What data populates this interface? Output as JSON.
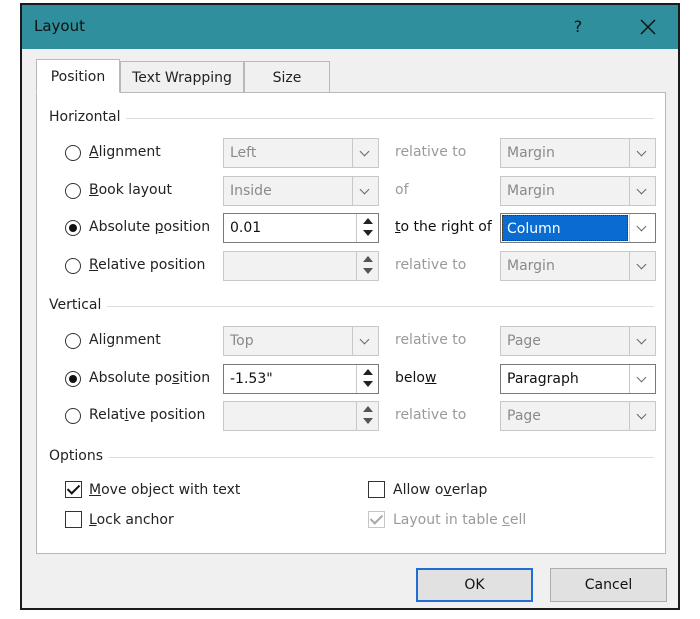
{
  "dialog": {
    "title": "Layout",
    "help": "?"
  },
  "tabs": [
    {
      "label": "Position"
    },
    {
      "label": "Text Wrapping"
    },
    {
      "label": "Size"
    }
  ],
  "horizontal": {
    "heading": "Horizontal",
    "rows": [
      {
        "label_pre": "",
        "label_u": "A",
        "label_post": "lignment",
        "checked": false,
        "value": "Left",
        "control": "dropdown",
        "mid_pre": "",
        "mid_u": "",
        "mid_post": "relative to",
        "target": "Margin"
      },
      {
        "label_pre": "",
        "label_u": "B",
        "label_post": "ook layout",
        "checked": false,
        "value": "Inside",
        "control": "dropdown",
        "mid_pre": "",
        "mid_u": "",
        "mid_post": "of",
        "target": "Margin"
      },
      {
        "label_pre": "Absolute ",
        "label_u": "p",
        "label_post": "osition",
        "checked": true,
        "value": "0.01",
        "control": "spin",
        "mid_pre": "",
        "mid_u": "t",
        "mid_post": "o the right of",
        "target": "Column"
      },
      {
        "label_pre": "",
        "label_u": "R",
        "label_post": "elative position",
        "checked": false,
        "value": "",
        "control": "spin",
        "mid_pre": "",
        "mid_u": "",
        "mid_post": "relative to",
        "target": "Margin"
      }
    ]
  },
  "vertical": {
    "heading": "Vertical",
    "rows": [
      {
        "label_pre": "Ali",
        "label_u": "g",
        "label_post": "nment",
        "checked": false,
        "value": "Top",
        "control": "dropdown",
        "mid_pre": "",
        "mid_u": "",
        "mid_post": "relative to",
        "target": "Page"
      },
      {
        "label_pre": "Absolute po",
        "label_u": "s",
        "label_post": "ition",
        "checked": true,
        "value": "-1.53\"",
        "control": "spin",
        "mid_pre": "belo",
        "mid_u": "w",
        "mid_post": "",
        "target": "Paragraph"
      },
      {
        "label_pre": "Relat",
        "label_u": "i",
        "label_post": "ve position",
        "checked": false,
        "value": "",
        "control": "spin",
        "mid_pre": "",
        "mid_u": "",
        "mid_post": "relative to",
        "target": "Page"
      }
    ]
  },
  "options": {
    "heading": "Options",
    "move_with_text": {
      "u": "M",
      "rest": "ove object with text",
      "checked": true
    },
    "lock_anchor": {
      "u": "L",
      "rest": "ock anchor",
      "checked": false
    },
    "allow_overlap": {
      "pre": "Allow o",
      "u": "v",
      "rest": "erlap",
      "checked": false
    },
    "layout_in_cell": {
      "pre": "Layout in table ",
      "u": "c",
      "rest": "ell",
      "checked": true,
      "disabled": true
    }
  },
  "buttons": {
    "ok": "OK",
    "cancel": "Cancel"
  }
}
